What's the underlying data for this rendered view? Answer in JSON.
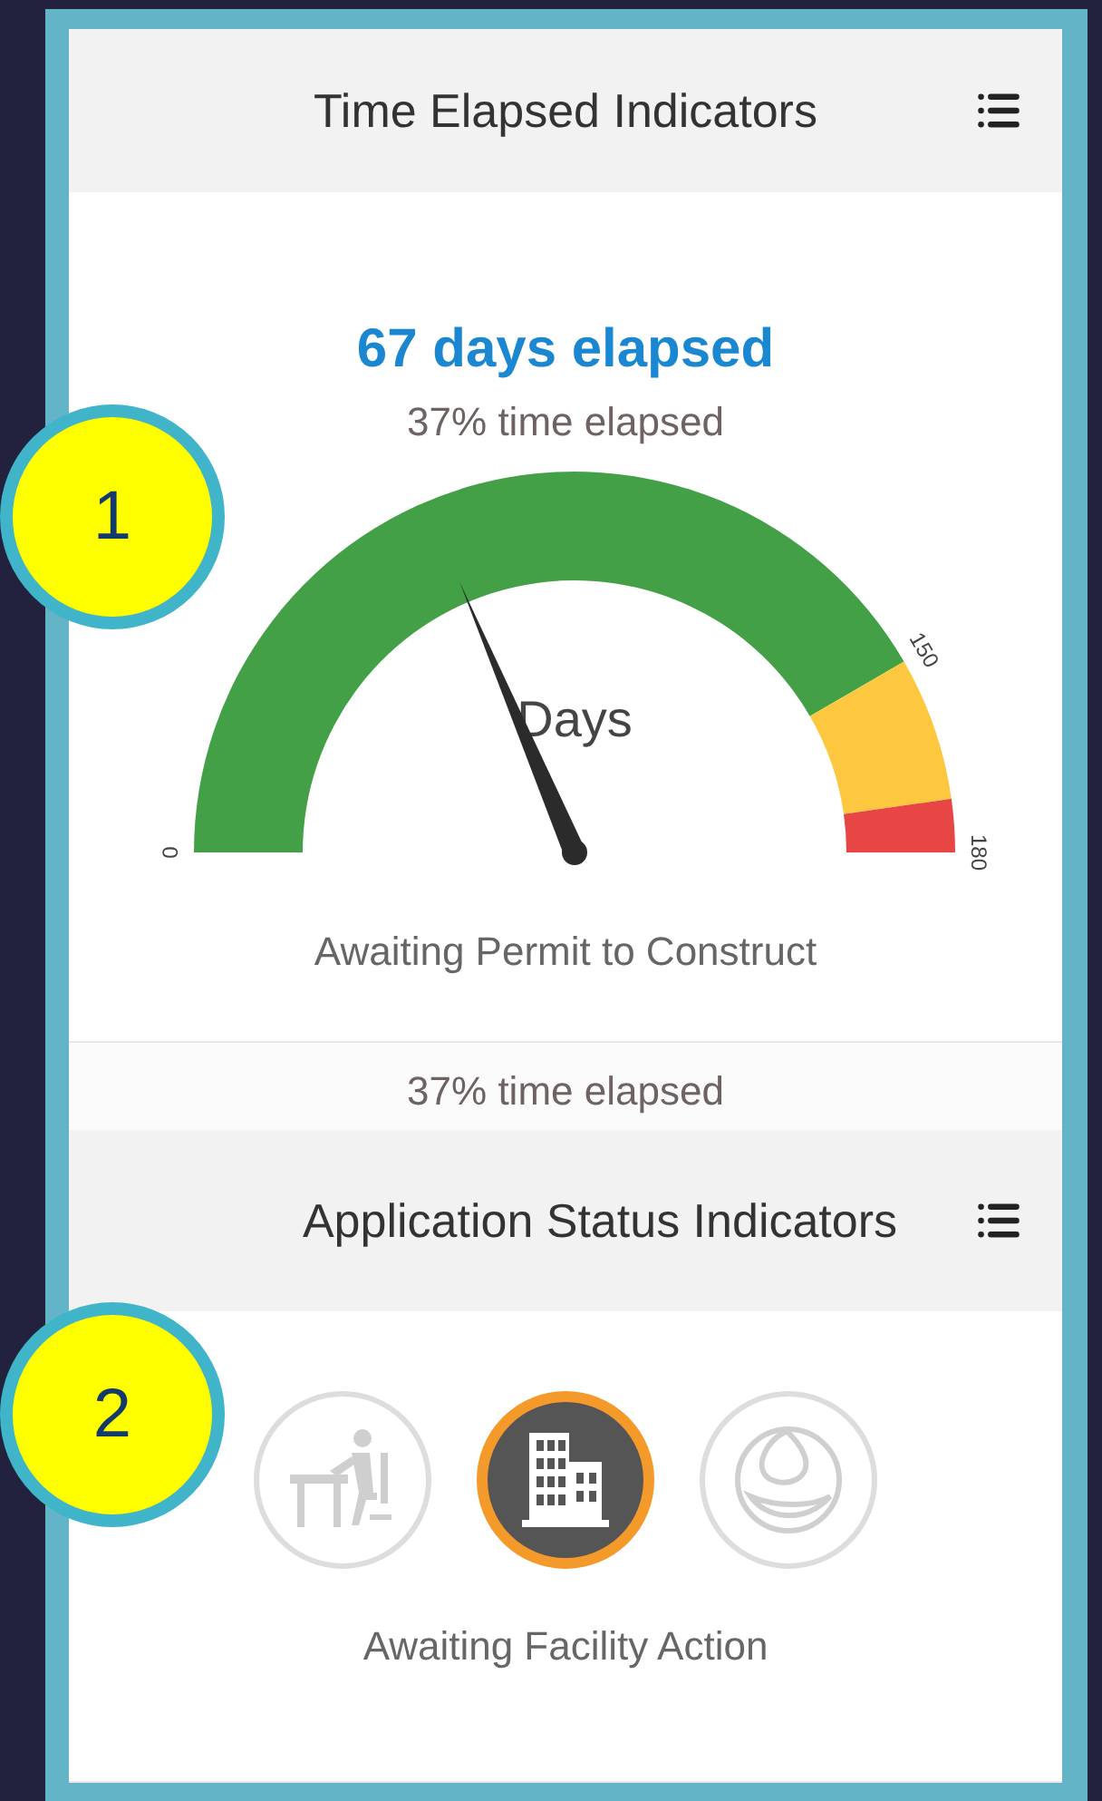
{
  "time_panel": {
    "title": "Time Elapsed Indicators",
    "headline": "67 days elapsed",
    "subtitle": "37% time elapsed",
    "gauge": {
      "unit": "Days",
      "bands": [
        {
          "color": "#43a047"
        },
        {
          "color": "#fdc83f"
        },
        {
          "color": "#e84545"
        }
      ],
      "ticks": [
        "0",
        "150",
        "180"
      ]
    },
    "caption": "Awaiting Permit to Construct",
    "footer": "37% time elapsed"
  },
  "status_panel": {
    "title": "Application Status Indicators",
    "steps": [
      {
        "kind": "desk",
        "selected": false
      },
      {
        "kind": "building",
        "selected": true
      },
      {
        "kind": "globe",
        "selected": false
      }
    ],
    "caption": "Awaiting Facility Action"
  },
  "callouts": [
    "1",
    "2"
  ]
}
